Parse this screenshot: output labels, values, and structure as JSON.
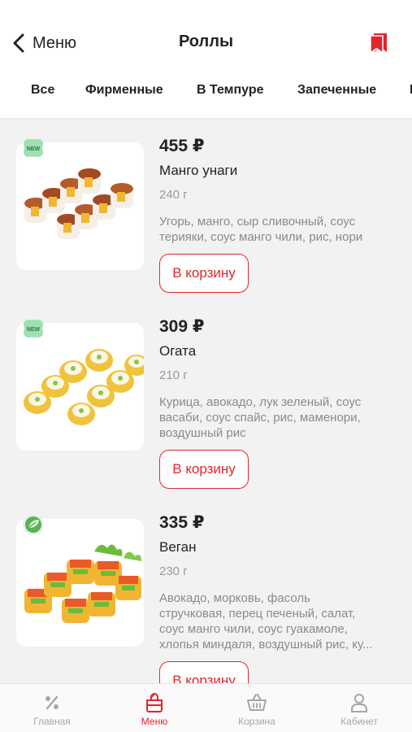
{
  "header": {
    "back_label": "Меню",
    "title": "Роллы"
  },
  "tabs": [
    "Все",
    "Фирменные",
    "В Темпуре",
    "Запеченные"
  ],
  "products": [
    {
      "price": "455 ₽",
      "name": "Манго унаги",
      "weight": "240 г",
      "desc_lines": [
        "Угорь, манго, сыр сливочный, соус",
        "терияки, соус манго чили, рис, нори"
      ],
      "button": "В корзину",
      "badge": "NEW"
    },
    {
      "price": "309 ₽",
      "name": "Огата",
      "weight": "210 г",
      "desc_lines": [
        "Курица, авокадо, лук зеленый, соус",
        "васаби, соус спайс, рис, маменори,",
        "воздушный рис"
      ],
      "button": "В корзину",
      "badge": "NEW"
    },
    {
      "price": "335 ₽",
      "name": "Веган",
      "weight": "230 г",
      "desc_lines": [
        "Авокадо, морковь, фасоль",
        "стручковая, перец печеный, салат,",
        "соус манго чили, соус гуакамоле,",
        "хлопья миндаля, воздушный рис, ку..."
      ],
      "button": "В корзину",
      "badge": "leaf"
    }
  ],
  "bottom_nav": [
    {
      "label": "Главная",
      "icon": "percent-icon",
      "active": false
    },
    {
      "label": "Меню",
      "icon": "menu-bag-icon",
      "active": true
    },
    {
      "label": "Корзина",
      "icon": "basket-icon",
      "active": false
    },
    {
      "label": "Кабинет",
      "icon": "user-icon",
      "active": false
    }
  ],
  "colors": {
    "accent": "#e0262a",
    "badge_green": "#7fd69a",
    "inactive": "#a6a6a6"
  }
}
